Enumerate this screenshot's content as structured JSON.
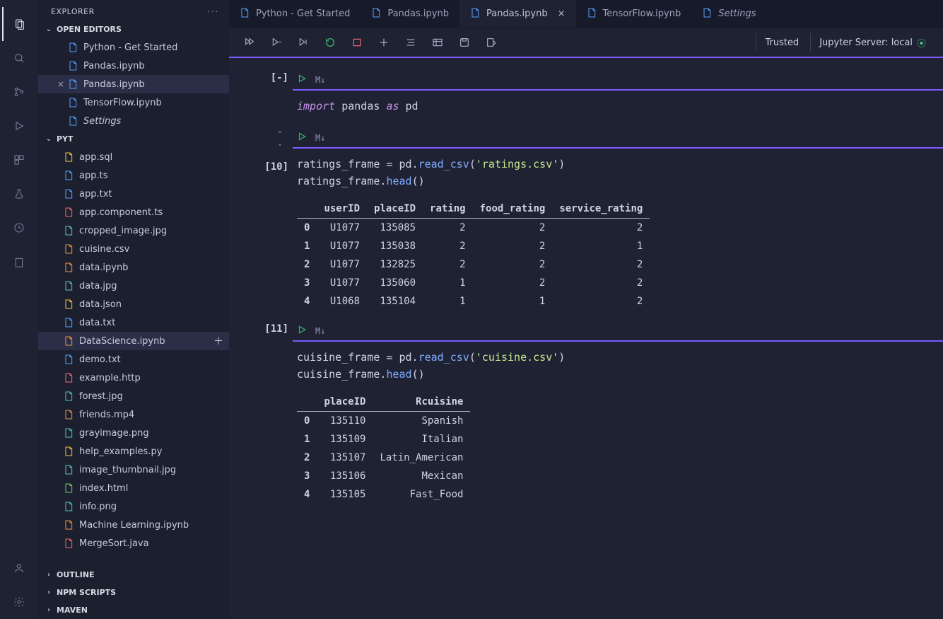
{
  "explorer": {
    "title": "EXPLORER"
  },
  "openEditors": {
    "title": "OPEN EDITORS",
    "items": [
      {
        "label": "Python - Get Started",
        "icon": "file-generic",
        "selected": false,
        "italic": false
      },
      {
        "label": "Pandas.ipynb",
        "icon": "notebook",
        "selected": false,
        "italic": false
      },
      {
        "label": "Pandas.ipynb",
        "icon": "notebook",
        "selected": true,
        "italic": false
      },
      {
        "label": "TensorFlow.ipynb",
        "icon": "notebook",
        "selected": false,
        "italic": false
      },
      {
        "label": "Settings",
        "icon": "file-generic",
        "selected": false,
        "italic": true
      }
    ]
  },
  "fileTree": {
    "root": "PYT",
    "items": [
      {
        "label": "app.sql",
        "icon": "database",
        "color": "c-yellow"
      },
      {
        "label": "app.ts",
        "icon": "ts",
        "color": "c-blue"
      },
      {
        "label": "app.txt",
        "icon": "txt",
        "color": "c-blue"
      },
      {
        "label": "app.component.ts",
        "icon": "angular",
        "color": "c-red"
      },
      {
        "label": "cropped_image.jpg",
        "icon": "image",
        "color": "c-teal"
      },
      {
        "label": "cuisine.csv",
        "icon": "csv",
        "color": "c-orange"
      },
      {
        "label": "data.ipynb",
        "icon": "jupyter",
        "color": "c-orange"
      },
      {
        "label": "data.jpg",
        "icon": "image",
        "color": "c-teal"
      },
      {
        "label": "data.json",
        "icon": "json",
        "color": "c-yellow"
      },
      {
        "label": "data.txt",
        "icon": "txt",
        "color": "c-blue"
      },
      {
        "label": "DataScience.ipynb",
        "icon": "jupyter",
        "color": "c-orange",
        "selected": true
      },
      {
        "label": "demo.txt",
        "icon": "txt",
        "color": "c-blue"
      },
      {
        "label": "example.http",
        "icon": "http",
        "color": "c-red"
      },
      {
        "label": "forest.jpg",
        "icon": "image",
        "color": "c-teal"
      },
      {
        "label": "friends.mp4",
        "icon": "video",
        "color": "c-orange"
      },
      {
        "label": "grayimage.png",
        "icon": "image",
        "color": "c-teal"
      },
      {
        "label": "help_examples.py",
        "icon": "python",
        "color": "c-yellow"
      },
      {
        "label": "image_thumbnail.jpg",
        "icon": "image",
        "color": "c-teal"
      },
      {
        "label": "index.html",
        "icon": "html",
        "color": "c-green"
      },
      {
        "label": "info.png",
        "icon": "image",
        "color": "c-teal"
      },
      {
        "label": "Machine Learning.ipynb",
        "icon": "jupyter",
        "color": "c-orange"
      },
      {
        "label": "MergeSort.java",
        "icon": "java",
        "color": "c-red"
      }
    ]
  },
  "bottomSections": [
    {
      "label": "OUTLINE"
    },
    {
      "label": "NPM SCRIPTS"
    },
    {
      "label": "MAVEN"
    }
  ],
  "tabs": [
    {
      "label": "Python - Get Started",
      "active": false,
      "close": false
    },
    {
      "label": "Pandas.ipynb",
      "active": false,
      "close": false
    },
    {
      "label": "Pandas.ipynb",
      "active": true,
      "close": true
    },
    {
      "label": "TensorFlow.ipynb",
      "active": false,
      "close": false
    },
    {
      "label": "Settings",
      "active": false,
      "close": false,
      "italic": true
    }
  ],
  "nbStatus": {
    "trusted": "Trusted",
    "server": "Jupyter Server: local"
  },
  "cells": [
    {
      "exec": "[-]",
      "md": "M↓",
      "code_html": "<span class='kw'>import</span> pandas <span class='as'>as</span> pd"
    },
    {
      "exec": "[10]",
      "md": "M↓",
      "code_html": "ratings_frame = pd.<span class='fn'>read_csv</span>(<span class='str'>'ratings.csv'</span>)\nratings_frame.<span class='fn'>head</span>()",
      "table": {
        "headers": [
          "",
          "userID",
          "placeID",
          "rating",
          "food_rating",
          "service_rating"
        ],
        "rows": [
          [
            "0",
            "U1077",
            "135085",
            "2",
            "2",
            "2"
          ],
          [
            "1",
            "U1077",
            "135038",
            "2",
            "2",
            "1"
          ],
          [
            "2",
            "U1077",
            "132825",
            "2",
            "2",
            "2"
          ],
          [
            "3",
            "U1077",
            "135060",
            "1",
            "2",
            "2"
          ],
          [
            "4",
            "U1068",
            "135104",
            "1",
            "1",
            "2"
          ]
        ]
      }
    },
    {
      "exec": "[11]",
      "md": "M↓",
      "code_html": "cuisine_frame = pd.<span class='fn'>read_csv</span>(<span class='str'>'cuisine.csv'</span>)\ncuisine_frame.<span class='fn'>head</span>()",
      "table": {
        "headers": [
          "",
          "placeID",
          "Rcuisine"
        ],
        "rows": [
          [
            "0",
            "135110",
            "Spanish"
          ],
          [
            "1",
            "135109",
            "Italian"
          ],
          [
            "2",
            "135107",
            "Latin_American"
          ],
          [
            "3",
            "135106",
            "Mexican"
          ],
          [
            "4",
            "135105",
            "Fast_Food"
          ]
        ]
      }
    }
  ]
}
